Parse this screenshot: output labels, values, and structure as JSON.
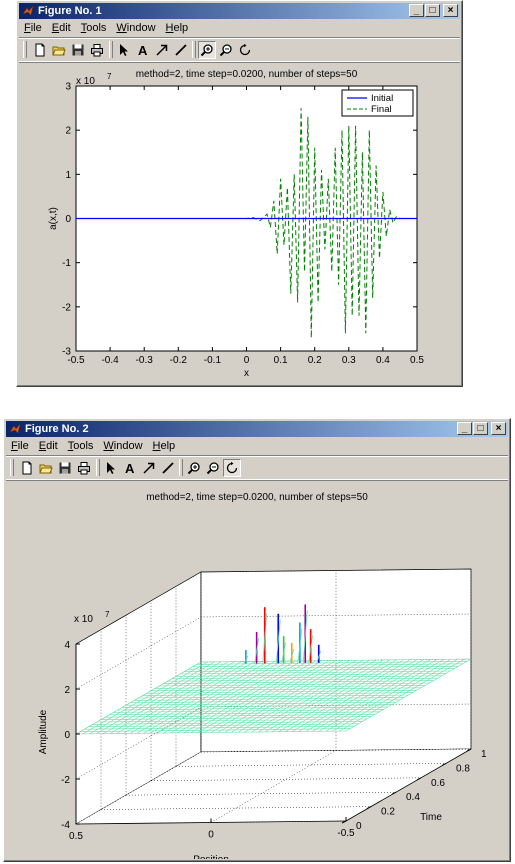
{
  "figure1": {
    "title": "Figure No. 1",
    "window_buttons": {
      "minimize": "_",
      "maximize": "□",
      "close": "×"
    },
    "menu": [
      {
        "label": "File",
        "key": "F",
        "rest": "ile"
      },
      {
        "label": "Edit",
        "key": "E",
        "rest": "dit"
      },
      {
        "label": "Tools",
        "key": "T",
        "rest": "ools"
      },
      {
        "label": "Window",
        "key": "W",
        "rest": "indow"
      },
      {
        "label": "Help",
        "key": "H",
        "rest": "elp"
      }
    ],
    "toolbar_icons": [
      "new-figure-icon",
      "open-file-icon",
      "save-icon",
      "print-icon",
      "edit-plot-arrow-icon",
      "insert-text-icon",
      "insert-arrow-icon",
      "insert-line-icon",
      "zoom-in-icon",
      "zoom-out-icon",
      "rotate-3d-icon"
    ],
    "active_tool": "zoom-in-icon",
    "plot": {
      "title": "method=2, time step=0.0200, number of steps=50",
      "xlabel": "x",
      "ylabel": "a(x,t)",
      "exponent_label": "x 10",
      "exponent_power": "7",
      "legend": [
        "Initial",
        "Final"
      ]
    }
  },
  "figure2": {
    "title": "Figure No. 2",
    "window_buttons": {
      "minimize": "_",
      "maximize": "□",
      "close": "×"
    },
    "menu": [
      {
        "label": "File",
        "key": "F",
        "rest": "ile"
      },
      {
        "label": "Edit",
        "key": "E",
        "rest": "dit"
      },
      {
        "label": "Tools",
        "key": "T",
        "rest": "ools"
      },
      {
        "label": "Window",
        "key": "W",
        "rest": "indow"
      },
      {
        "label": "Help",
        "key": "H",
        "rest": "elp"
      }
    ],
    "toolbar_icons": [
      "new-figure-icon",
      "open-file-icon",
      "save-icon",
      "print-icon",
      "edit-plot-arrow-icon",
      "insert-text-icon",
      "insert-arrow-icon",
      "insert-line-icon",
      "zoom-in-icon",
      "zoom-out-icon",
      "rotate-3d-icon"
    ],
    "active_tool": "rotate-3d-icon",
    "plot": {
      "title": "method=2, time step=0.0200, number of steps=50",
      "xlabel": "Position",
      "ylabel": "Time",
      "zlabel": "Amplitude",
      "exponent_label": "x 10",
      "exponent_power": "7"
    }
  },
  "colors": {
    "window_bg": "#d4d0c8",
    "title_active": "#0a246a",
    "initial_line": "#0000ff",
    "final_line": "#007f00",
    "surface_mesh": "#5fe0a8"
  },
  "chart_data": [
    {
      "type": "line",
      "title": "method=2, time step=0.0200, number of steps=50",
      "xlabel": "x",
      "ylabel": "a(x,t)",
      "xlim": [
        -0.5,
        0.5
      ],
      "ylim": [
        -3,
        3
      ],
      "y_scale_factor": "x 10^7",
      "xticks": [
        "-0.5",
        "-0.4",
        "-0.3",
        "-0.2",
        "-0.1",
        "0",
        "0.1",
        "0.2",
        "0.3",
        "0.4",
        "0.5"
      ],
      "yticks": [
        "-3",
        "-2",
        "-1",
        "0",
        "1",
        "2",
        "3"
      ],
      "legend_position": "top-right",
      "series": [
        {
          "name": "Initial",
          "style": "solid",
          "color": "#0000ff",
          "x": [
            -0.5,
            0.5
          ],
          "y": [
            0,
            0
          ]
        },
        {
          "name": "Final",
          "style": "dashed",
          "color": "#007f00",
          "x": [
            -0.5,
            -0.45,
            -0.4,
            -0.35,
            -0.3,
            -0.25,
            -0.2,
            -0.15,
            -0.1,
            -0.05,
            0.0,
            0.02,
            0.04,
            0.06,
            0.07,
            0.08,
            0.09,
            0.1,
            0.11,
            0.12,
            0.13,
            0.14,
            0.15,
            0.16,
            0.17,
            0.18,
            0.19,
            0.2,
            0.21,
            0.22,
            0.23,
            0.24,
            0.25,
            0.26,
            0.27,
            0.28,
            0.29,
            0.3,
            0.31,
            0.32,
            0.33,
            0.34,
            0.35,
            0.36,
            0.37,
            0.38,
            0.39,
            0.4,
            0.41,
            0.42,
            0.43,
            0.44,
            0.45,
            0.46,
            0.5
          ],
          "y": [
            0,
            0,
            0,
            0,
            0,
            0,
            0,
            0,
            0,
            0,
            0,
            0.02,
            -0.05,
            0.1,
            -0.2,
            0.4,
            -0.8,
            0.9,
            -0.6,
            0.7,
            -1.7,
            1.0,
            -1.9,
            2.5,
            -1.2,
            2.3,
            -2.7,
            1.6,
            -1.9,
            1.1,
            -0.7,
            0.9,
            -1.2,
            1.6,
            -1.5,
            2.0,
            -2.6,
            2.1,
            -2.2,
            2.1,
            -2.2,
            1.5,
            -2.6,
            2.0,
            -1.8,
            1.2,
            -0.9,
            0.6,
            -0.4,
            0.2,
            -0.1,
            0.05,
            0,
            0,
            0
          ]
        }
      ]
    },
    {
      "type": "surface",
      "title": "method=2, time step=0.0200, number of steps=50",
      "xlabel": "Position",
      "ylabel": "Time",
      "zlabel": "Amplitude",
      "xlim": [
        -0.5,
        0.5
      ],
      "ylim": [
        0,
        1
      ],
      "zlim": [
        -4,
        4
      ],
      "z_scale_factor": "x 10^7",
      "xticks": [
        "0.5",
        "0",
        "-0.5"
      ],
      "yticks": [
        "0",
        "0.2",
        "0.4",
        "0.6",
        "0.8",
        "1"
      ],
      "zticks": [
        "-4",
        "-2",
        "0",
        "2",
        "4"
      ],
      "grid": true,
      "description_spikes_at_time": 1,
      "spike_positions": [
        0.05,
        0.08,
        0.1,
        0.12,
        0.15,
        0.18,
        0.2,
        0.25,
        0.28,
        0.32
      ],
      "spike_heights": [
        0.8,
        1.5,
        2.6,
        1.8,
        0.9,
        1.2,
        2.2,
        2.5,
        1.4,
        0.6
      ]
    }
  ]
}
